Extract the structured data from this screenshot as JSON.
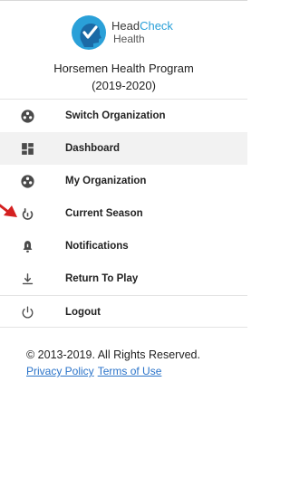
{
  "logo": {
    "brand_part1": "Head",
    "brand_part2": "Check",
    "brand_line2": "Health",
    "brand_color": "#2aa0d8"
  },
  "organization": {
    "name": "Horsemen Health Program",
    "season": "(2019-2020)"
  },
  "menu": {
    "items": [
      {
        "label": "Switch Organization",
        "icon": "organization-icon"
      },
      {
        "label": "Dashboard",
        "icon": "dashboard-icon",
        "active": true
      },
      {
        "label": "My Organization",
        "icon": "organization-icon"
      },
      {
        "label": "Current Season",
        "icon": "current-season-icon"
      },
      {
        "label": "Notifications",
        "icon": "bell-icon"
      },
      {
        "label": "Return To Play",
        "icon": "download-arrow-icon"
      },
      {
        "label": "Logout",
        "icon": "power-icon"
      }
    ]
  },
  "footer": {
    "copyright": "© 2013-2019. All Rights Reserved.",
    "privacy_label": "Privacy Policy",
    "terms_label": "Terms of Use"
  },
  "colors": {
    "link": "#2a73c9",
    "active_bg": "#f2f2f2",
    "annotation_arrow": "#d42020"
  }
}
